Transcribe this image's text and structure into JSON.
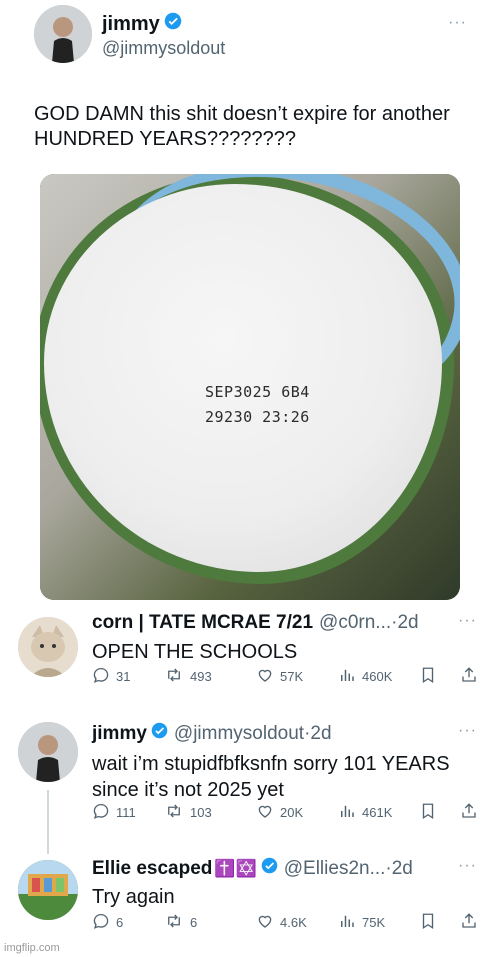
{
  "main_post": {
    "display_name": "jimmy",
    "handle": "@jimmysoldout",
    "more": "···",
    "text": "GOD DAMN this shit doesn’t expire for another HUNDRED YEARS????????",
    "image": {
      "stamp_line1": "SEP3025 6B4",
      "stamp_line2": "29230 23:26"
    }
  },
  "replies": [
    {
      "display_name": "corn | TATE MCRAE 7/21",
      "handle_time": "@c0rn...·2d",
      "more": "···",
      "text": "OPEN THE SCHOOLS",
      "replies": "31",
      "reposts": "493",
      "likes": "57K",
      "views": "460K"
    },
    {
      "display_name": "jimmy",
      "handle_time": "@jimmysoldout·2d",
      "more": "···",
      "text": "wait i’m stupidfbfksnfn sorry 101 YEARS since it’s not 2025 yet",
      "replies": "111",
      "reposts": "103",
      "likes": "20K",
      "views": "461K"
    },
    {
      "display_name": "Ellie escaped",
      "emoji": "✝️✡️",
      "handle_time": "@Ellies2n...·2d",
      "more": "···",
      "text": "Try again",
      "replies": "6",
      "reposts": "6",
      "likes": "4.6K",
      "views": "75K"
    }
  ],
  "watermark": "imgflip.com",
  "colors": {
    "verified_blue": "#1d9bf0",
    "text_primary": "#0f1419",
    "text_secondary": "#536471"
  },
  "icons": [
    "verified-badge-icon",
    "more-icon",
    "reply-icon",
    "repost-icon",
    "like-icon",
    "views-icon",
    "bookmark-icon",
    "share-icon"
  ]
}
